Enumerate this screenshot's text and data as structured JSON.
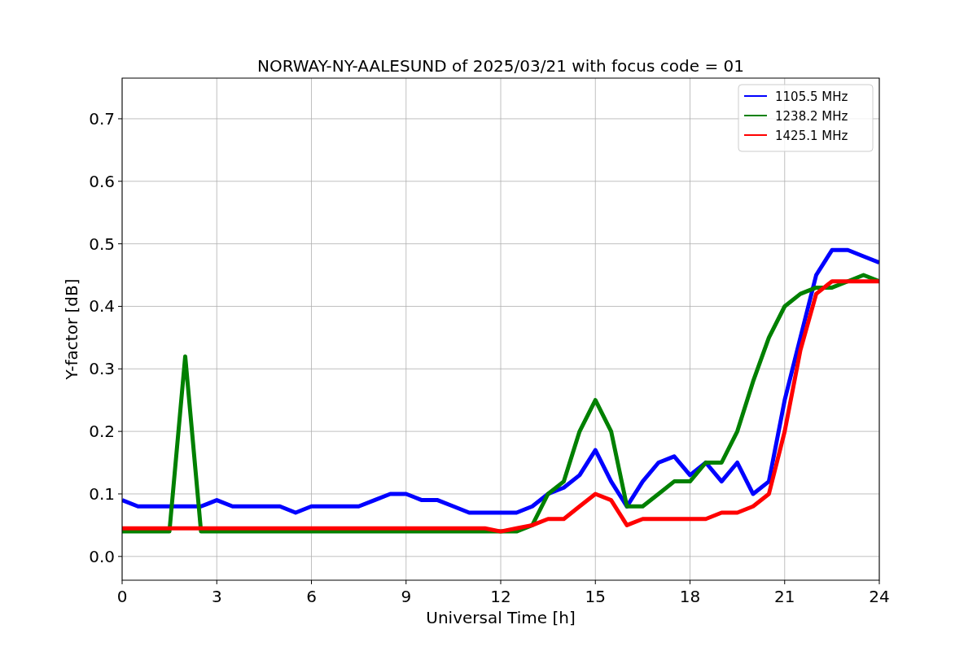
{
  "chart_data": {
    "type": "line",
    "title": "NORWAY-NY-AALESUND of 2025/03/21 with focus code = 01",
    "xlabel": "Universal Time [h]",
    "ylabel": "Y-factor [dB]",
    "x": [
      0,
      0.5,
      1,
      1.5,
      2,
      2.5,
      3,
      3.5,
      4,
      4.5,
      5,
      5.5,
      6,
      6.5,
      7,
      7.5,
      8,
      8.5,
      9,
      9.5,
      10,
      10.5,
      11,
      11.5,
      12,
      12.5,
      13,
      13.5,
      14,
      14.5,
      15,
      15.5,
      16,
      16.5,
      17,
      17.5,
      18,
      18.5,
      19,
      19.5,
      20,
      20.5,
      21,
      21.5,
      22,
      22.5,
      23,
      23.5,
      24
    ],
    "series": [
      {
        "name": "1105.5 MHz",
        "color": "#0000ff",
        "values": [
          0.09,
          0.08,
          0.08,
          0.08,
          0.08,
          0.08,
          0.09,
          0.08,
          0.08,
          0.08,
          0.08,
          0.07,
          0.08,
          0.08,
          0.08,
          0.08,
          0.09,
          0.1,
          0.1,
          0.09,
          0.09,
          0.08,
          0.07,
          0.07,
          0.07,
          0.07,
          0.08,
          0.1,
          0.11,
          0.13,
          0.17,
          0.12,
          0.08,
          0.12,
          0.15,
          0.16,
          0.13,
          0.15,
          0.12,
          0.15,
          0.1,
          0.12,
          0.25,
          0.35,
          0.45,
          0.49,
          0.49,
          0.48,
          0.47
        ]
      },
      {
        "name": "1238.2 MHz",
        "color": "#008000",
        "values": [
          0.04,
          0.04,
          0.04,
          0.04,
          0.32,
          0.04,
          0.04,
          0.04,
          0.04,
          0.04,
          0.04,
          0.04,
          0.04,
          0.04,
          0.04,
          0.04,
          0.04,
          0.04,
          0.04,
          0.04,
          0.04,
          0.04,
          0.04,
          0.04,
          0.04,
          0.04,
          0.05,
          0.1,
          0.12,
          0.2,
          0.25,
          0.2,
          0.08,
          0.08,
          0.1,
          0.12,
          0.12,
          0.15,
          0.15,
          0.2,
          0.28,
          0.35,
          0.4,
          0.42,
          0.43,
          0.43,
          0.44,
          0.45,
          0.44
        ]
      },
      {
        "name": "1425.1 MHz",
        "color": "#ff0000",
        "values": [
          0.045,
          0.045,
          0.045,
          0.045,
          0.045,
          0.045,
          0.045,
          0.045,
          0.045,
          0.045,
          0.045,
          0.045,
          0.045,
          0.045,
          0.045,
          0.045,
          0.045,
          0.045,
          0.045,
          0.045,
          0.045,
          0.045,
          0.045,
          0.045,
          0.04,
          0.045,
          0.05,
          0.06,
          0.06,
          0.08,
          0.1,
          0.09,
          0.05,
          0.06,
          0.06,
          0.06,
          0.06,
          0.06,
          0.07,
          0.07,
          0.08,
          0.1,
          0.2,
          0.33,
          0.42,
          0.44,
          0.44,
          0.44,
          0.44
        ]
      }
    ],
    "grid": true,
    "legend": true,
    "xlim": [
      0,
      24
    ],
    "ylim": [
      -0.038,
      0.765
    ],
    "xticks": [
      0,
      3,
      6,
      9,
      12,
      15,
      18,
      21,
      24
    ],
    "yticks": [
      {
        "value": 0,
        "label": "0.0"
      },
      {
        "value": 0.1,
        "label": "0.1"
      },
      {
        "value": 0.2,
        "label": "0.2"
      },
      {
        "value": 0.3,
        "label": "0.3"
      },
      {
        "value": 0.4,
        "label": "0.4"
      },
      {
        "value": 0.5,
        "label": "0.5"
      },
      {
        "value": 0.6,
        "label": "0.6"
      },
      {
        "value": 0.7,
        "label": "0.7"
      }
    ]
  }
}
